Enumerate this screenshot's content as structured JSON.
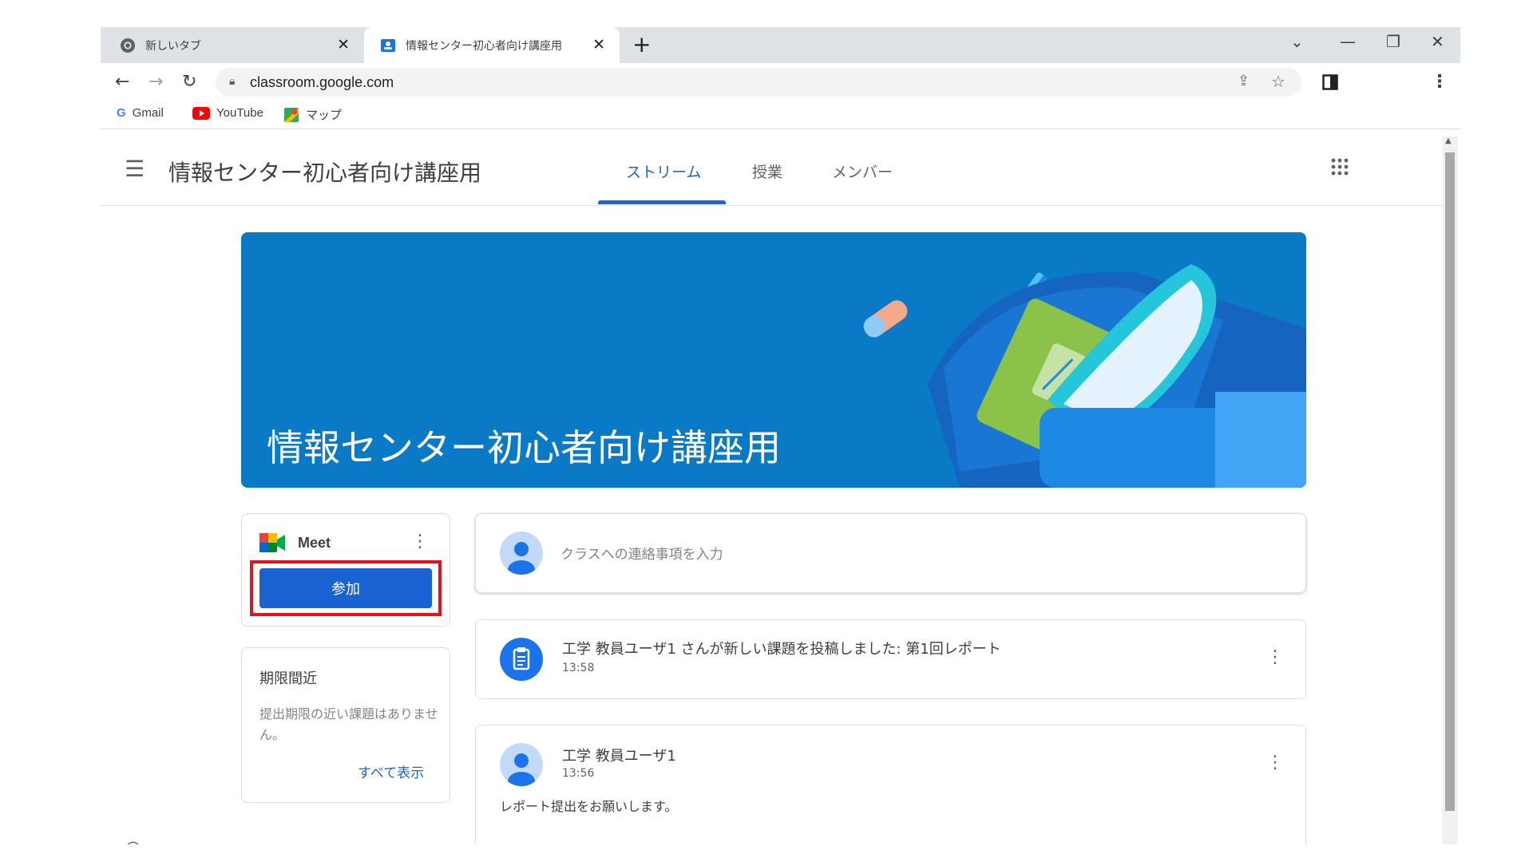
{
  "browser": {
    "tabs": [
      {
        "title": "新しいタブ",
        "icon": "chrome-icon"
      },
      {
        "title": "情報センター初心者向け講座用",
        "icon": "classroom-icon"
      }
    ],
    "new_tab_symbol": "+",
    "url": "classroom.google.com",
    "bookmarks": [
      {
        "label": "Gmail",
        "icon": "google-icon"
      },
      {
        "label": "YouTube",
        "icon": "youtube-icon"
      },
      {
        "label": "マップ",
        "icon": "maps-icon"
      }
    ]
  },
  "classroom": {
    "class_title": "情報センター初心者向け講座用",
    "nav_tabs": [
      "ストリーム",
      "授業",
      "メンバー"
    ],
    "active_tab": "ストリーム",
    "banner_title": "情報センター初心者向け講座用",
    "meet": {
      "label": "Meet",
      "join_label": "参加"
    },
    "upcoming": {
      "title": "期限間近",
      "body": "提出期限の近い課題はありません。",
      "view_all": "すべて表示"
    },
    "announce_placeholder": "クラスへの連絡事項を入力",
    "posts": [
      {
        "text": "工学 教員ユーザ1 さんが新しい課題を投稿しました: 第1回レポート",
        "time": "13:58",
        "icon": "assignment-icon"
      },
      {
        "author": "工学 教員ユーザ1",
        "time": "13:56",
        "body": "レポート提出をお願いします。",
        "icon": "avatar-icon"
      }
    ]
  },
  "colors": {
    "accent": "#1967d2",
    "banner": "#0b7ac6",
    "highlight": "#e0141e",
    "join_button": "#1a62d2"
  }
}
